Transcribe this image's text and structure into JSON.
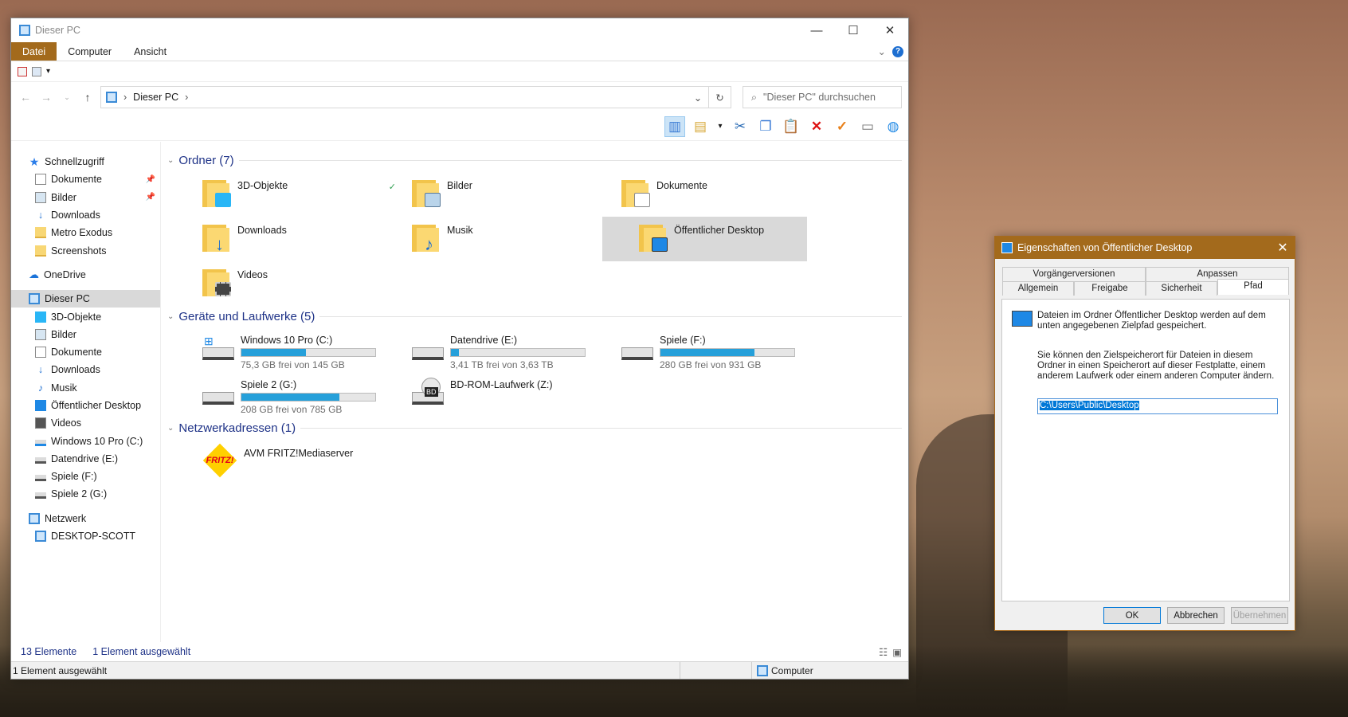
{
  "explorer": {
    "title": "Dieser PC",
    "ribbon_tabs": [
      "Datei",
      "Computer",
      "Ansicht"
    ],
    "breadcrumb": "Dieser PC",
    "search_placeholder": "\"Dieser PC\" durchsuchen",
    "nav": {
      "quick_access": "Schnellzugriff",
      "quick_items": [
        "Dokumente",
        "Bilder",
        "Downloads",
        "Metro Exodus",
        "Screenshots"
      ],
      "onedrive": "OneDrive",
      "this_pc": "Dieser PC",
      "pc_items": [
        "3D-Objekte",
        "Bilder",
        "Dokumente",
        "Downloads",
        "Musik",
        "Öffentlicher Desktop",
        "Videos",
        "Windows 10 Pro (C:)",
        "Datendrive (E:)",
        "Spiele (F:)",
        "Spiele 2 (G:)"
      ],
      "network": "Netzwerk",
      "network_items": [
        "DESKTOP-SCOTT"
      ]
    },
    "groups": {
      "folders_title": "Ordner (7)",
      "folders": [
        "3D-Objekte",
        "Bilder",
        "Dokumente",
        "Downloads",
        "Musik",
        "Öffentlicher Desktop",
        "Videos"
      ],
      "drives_title": "Geräte und Laufwerke (5)",
      "drives": [
        {
          "name": "Windows 10 Pro (C:)",
          "free": "75,3 GB frei von 145 GB",
          "used_fraction": 0.48
        },
        {
          "name": "Datendrive (E:)",
          "free": "3,41 TB frei von 3,63 TB",
          "used_fraction": 0.06
        },
        {
          "name": "Spiele (F:)",
          "free": "280 GB frei von 931 GB",
          "used_fraction": 0.7
        },
        {
          "name": "Spiele 2 (G:)",
          "free": "208 GB frei von 785 GB",
          "used_fraction": 0.735
        },
        {
          "name": "BD-ROM-Laufwerk (Z:)",
          "badge": "BD"
        }
      ],
      "network_title": "Netzwerkadressen (1)",
      "network": [
        "AVM FRITZ!Mediaserver"
      ],
      "fritz_logo": "FRITZ!"
    },
    "status": {
      "count": "13 Elemente",
      "selected": "1 Element ausgewählt"
    },
    "bottom": {
      "left": "1 Element ausgewählt",
      "right": "Computer"
    }
  },
  "dialog": {
    "title": "Eigenschaften von Öffentlicher Desktop",
    "tabs_top": [
      "Vorgängerversionen",
      "Anpassen"
    ],
    "tabs_bottom": [
      "Allgemein",
      "Freigabe",
      "Sicherheit",
      "Pfad"
    ],
    "text1": "Dateien im Ordner Öffentlicher Desktop werden auf dem unten angegebenen Zielpfad gespeichert.",
    "text2": "Sie können den Zielspeicherort für Dateien in diesem Ordner in einen Speicherort auf dieser Festplatte, einem anderem Laufwerk oder einem anderen Computer ändern.",
    "path": "C:\\Users\\Public\\Desktop",
    "buttons": [
      "OK",
      "Abbrechen",
      "Übernehmen"
    ]
  },
  "colors": {
    "accent": "#a36a1c",
    "selection": "#d9d9d9",
    "bar": "#26a0da",
    "link": "#1e3287"
  }
}
